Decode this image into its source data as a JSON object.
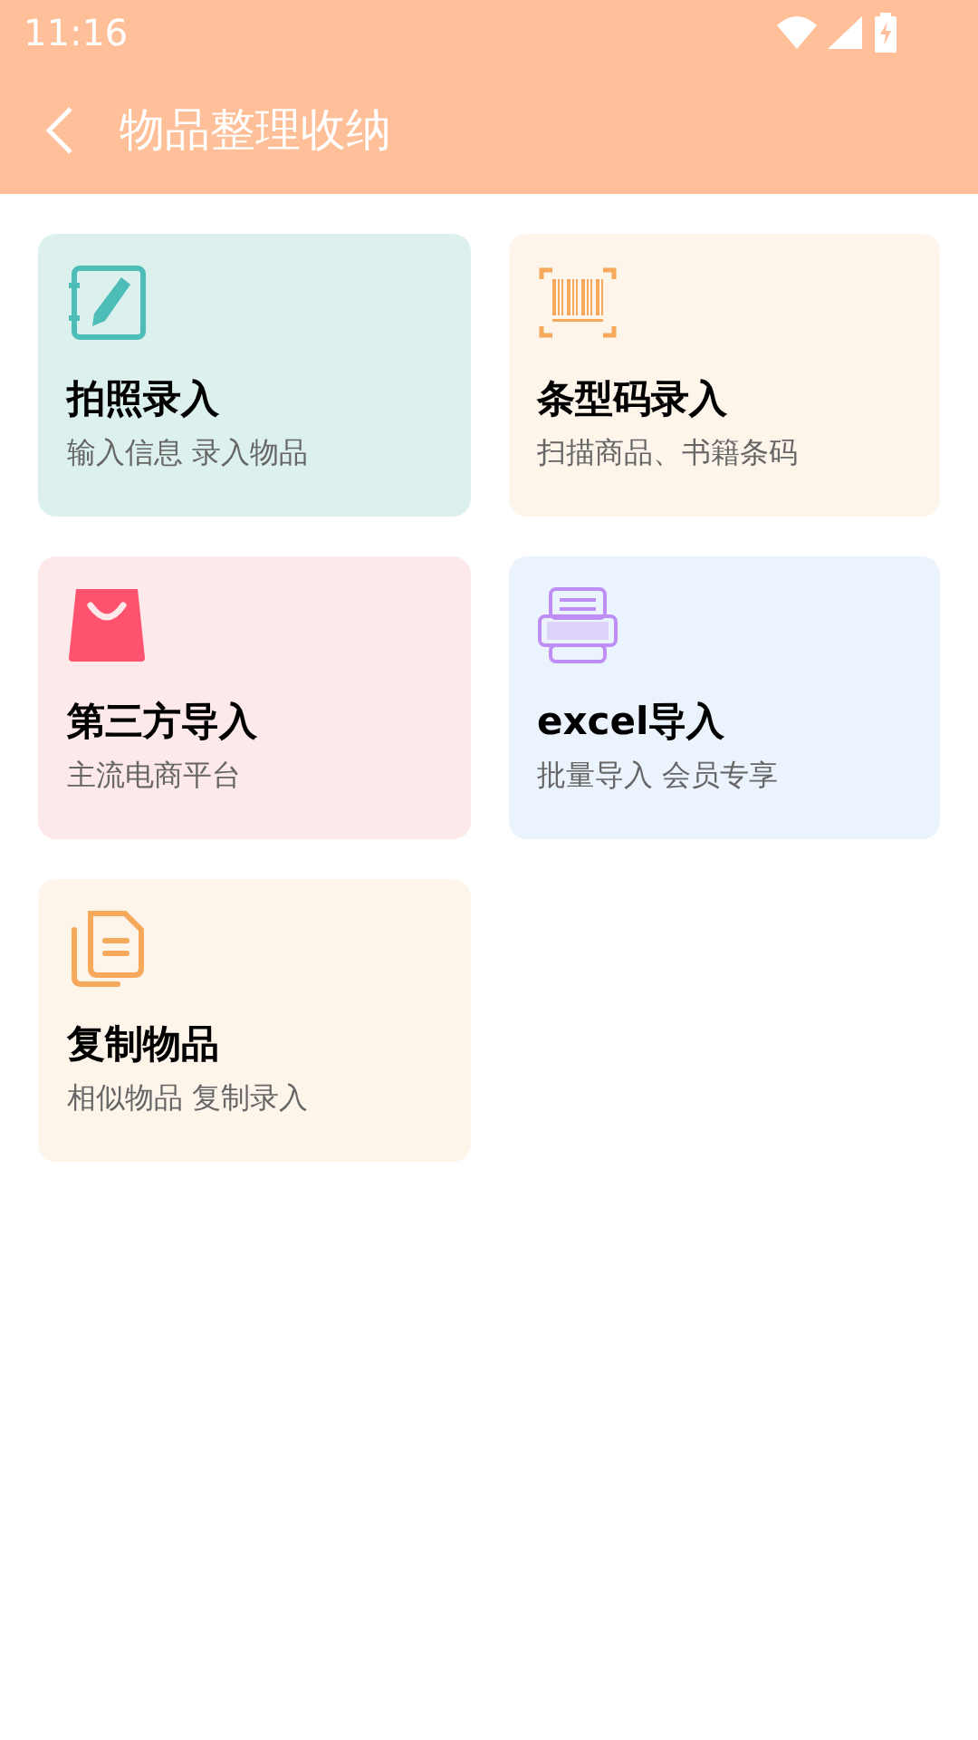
{
  "status_bar": {
    "time": "11:16"
  },
  "app_bar": {
    "title": "物品整理收纳"
  },
  "cards": [
    {
      "kind": "photo",
      "title": "拍照录入",
      "subtitle": "输入信息 录入物品",
      "color": "#dcf0ee"
    },
    {
      "kind": "barcode",
      "title": "条型码录入",
      "subtitle": "扫描商品、书籍条码",
      "color": "#fdf4ea"
    },
    {
      "kind": "shop",
      "title": "第三方导入",
      "subtitle": "主流电商平台",
      "color": "#fde8ea"
    },
    {
      "kind": "excel",
      "title": "excel导入",
      "subtitle": "批量导入 会员专享",
      "color": "#ebf3fc"
    },
    {
      "kind": "copy",
      "title": "复制物品",
      "subtitle": "相似物品 复制录入",
      "color": "#fdf4ea"
    }
  ]
}
